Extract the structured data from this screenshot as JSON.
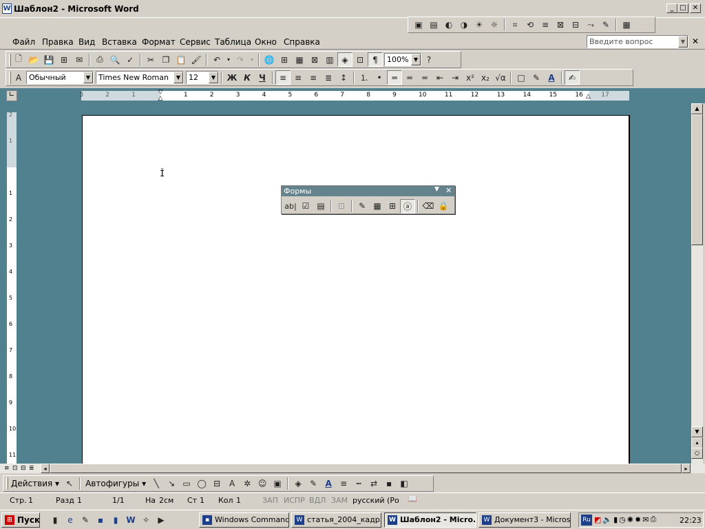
{
  "window": {
    "title": "Шаблон2 - Microsoft Word",
    "app_icon": "W",
    "min": "_",
    "max": "□",
    "close": "✕"
  },
  "menu": {
    "items": [
      "Файл",
      "Правка",
      "Вид",
      "Вставка",
      "Формат",
      "Сервис",
      "Таблица",
      "Окно",
      "Справка"
    ],
    "ask_placeholder": "Введите вопрос",
    "close": "✕"
  },
  "standard_toolbar": {
    "zoom": "100%"
  },
  "formatting_toolbar": {
    "style": "Обычный",
    "font": "Times New Roman",
    "size": "12",
    "bold": "Ж",
    "italic": "К",
    "underline": "Ч"
  },
  "ruler": {
    "labels": [
      "3",
      "2",
      "1",
      "1",
      "2",
      "3",
      "4",
      "5",
      "6",
      "7",
      "8",
      "9",
      "10",
      "11",
      "12",
      "13",
      "14",
      "15",
      "16",
      "17"
    ]
  },
  "vruler": {
    "labels": [
      "2",
      "1",
      "1",
      "2",
      "3",
      "4",
      "5",
      "6",
      "7",
      "8",
      "9",
      "10",
      "11"
    ]
  },
  "forms_toolbar": {
    "title": "Формы",
    "text_field": "ab|"
  },
  "drawing_toolbar": {
    "actions": "Действия",
    "autoshapes": "Автофигуры"
  },
  "status": {
    "page": "Стр.",
    "page_num": "1",
    "section": "Разд",
    "section_num": "1",
    "pages": "1/1",
    "at": "На",
    "at_val": "2см",
    "line": "Ст",
    "line_val": "1",
    "col": "Кол",
    "col_val": "1",
    "rec": "ЗАП",
    "trk": "ИСПР",
    "ext": "ВДЛ",
    "ovr": "ЗАМ",
    "lang": "русский (Ро"
  },
  "taskbar": {
    "start": "Пуск",
    "buttons": [
      "Windows Commande...",
      "статья_2004_кадр...",
      "Шаблон2 - Micro...",
      "Документ3 - Micros..."
    ],
    "lang": "Ru",
    "clock": "22:23"
  },
  "colors": {
    "workspace": "#51808f",
    "title_accent": "#1d3f8a",
    "forms_title": "#65838d"
  }
}
